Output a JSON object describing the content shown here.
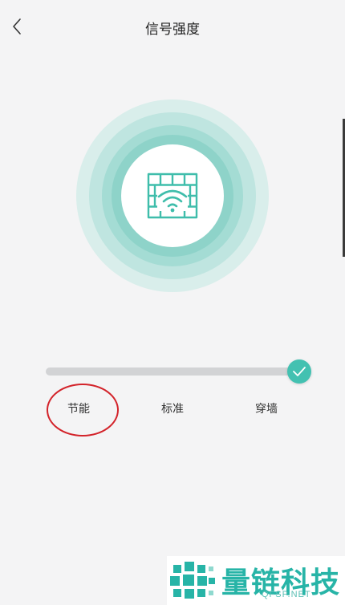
{
  "header": {
    "title": "信号强度",
    "back_icon": "chevron-left-icon"
  },
  "signal_graphic": {
    "icon": "router-wifi-icon",
    "ring_colors": [
      "#d9eeeb",
      "#bfe5e0",
      "#a4dcd4",
      "#8ed3c9"
    ],
    "accent": "#3fbdab"
  },
  "strength_slider": {
    "levels": [
      "节能",
      "标准",
      "穿墙"
    ],
    "selected_index": 2,
    "value_fraction": 1.0,
    "thumb_icon": "check-icon",
    "thumb_color": "#43c1b1",
    "track_color": "#d2d3d5"
  },
  "annotation": {
    "color": "#d3232a"
  },
  "watermark": {
    "name": "量链科技",
    "url": "QFSP.NET",
    "color": "#27b4a7"
  }
}
